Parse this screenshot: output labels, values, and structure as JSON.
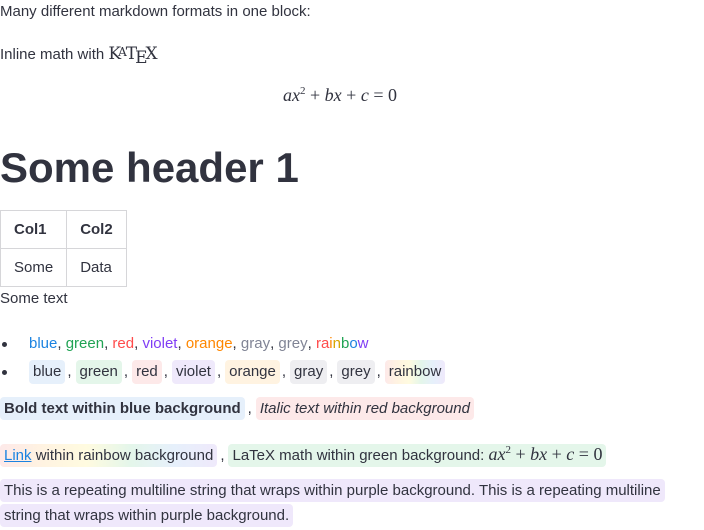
{
  "intro": "Many different markdown formats in one block:",
  "inline_math_prefix": "Inline math with",
  "katex_logo": "KaTeX",
  "display_equation": {
    "a": "a",
    "x": "x",
    "exp": "2",
    "plus1": "+",
    "b": "b",
    "x2": "x",
    "plus2": "+",
    "c": "c",
    "eq": "=",
    "zero": "0"
  },
  "header1": "Some header 1",
  "table": {
    "headers": [
      "Col1",
      "Col2"
    ],
    "rows": [
      [
        "Some",
        "Data"
      ]
    ]
  },
  "some_text": "Some text",
  "list_colored": [
    "blue",
    "green",
    "red",
    "violet",
    "orange",
    "gray",
    "grey",
    "rainbow"
  ],
  "list_bg": [
    "blue",
    "green",
    "red",
    "violet",
    "orange",
    "gray",
    "grey",
    "rainbow"
  ],
  "separator": ",",
  "line_bold": {
    "bold_blue": "Bold text within blue background",
    "italic_red": "Italic text within red background"
  },
  "line_link": {
    "link_text": "Link",
    "rainbow_rest": " within rainbow background",
    "green_text": "LaTeX math within green background:"
  },
  "paragraph": "This is a repeating multiline string that wraps within purple background. This is a repeating multiline string that wraps within purple background.",
  "colors": {
    "text": "#31333f",
    "blue": "#1c83e1",
    "green": "#21a354",
    "red": "#ff4b4b",
    "violet": "#803df5",
    "orange": "#ff8700",
    "gray": "#808495"
  }
}
